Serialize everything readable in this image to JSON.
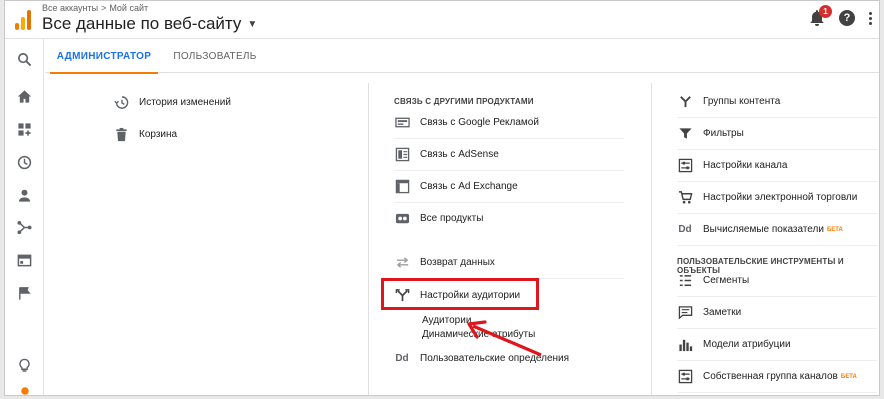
{
  "breadcrumb": {
    "account": "Все аккаунты",
    "separator": ">",
    "property": "Мой сайт"
  },
  "view_title": "Все данные по веб-сайту",
  "notifications_count": "1",
  "help_label": "?",
  "tabs": [
    {
      "label": "АДМИНИСТРАТОР",
      "active": true
    },
    {
      "label": "ПОЛЬЗОВАТЕЛЬ",
      "active": false
    }
  ],
  "account_column": {
    "items": [
      {
        "label": "История изменений",
        "icon": "history-icon"
      },
      {
        "label": "Корзина",
        "icon": "trash-icon"
      }
    ]
  },
  "property_column": {
    "section_label": "СВЯЗЬ С ДРУГИМИ ПРОДУКТАМИ",
    "items": [
      {
        "label": "Связь с Google Рекламой",
        "icon": "google-ads-icon"
      },
      {
        "label": "Связь с AdSense",
        "icon": "adsense-icon"
      },
      {
        "label": "Связь с Ad Exchange",
        "icon": "ad-exchange-icon"
      },
      {
        "label": "Все продукты",
        "icon": "all-products-icon"
      },
      {
        "label": "Возврат данных",
        "icon": "postbacks-icon"
      },
      {
        "label": "Настройки аудитории",
        "icon": "audience-icon"
      }
    ],
    "audience_sub": [
      "Аудитории",
      "Динамические атрибуты"
    ],
    "custom_definitions": {
      "label": "Пользовательские определения",
      "icon": "dd-icon"
    }
  },
  "view_column": {
    "items": [
      {
        "label": "Группы контента",
        "icon": "content-grouping-icon"
      },
      {
        "label": "Фильтры",
        "icon": "filter-icon"
      },
      {
        "label": "Настройки канала",
        "icon": "channel-settings-icon"
      },
      {
        "label": "Настройки электронной торговли",
        "icon": "cart-icon"
      },
      {
        "label": "Вычисляемые показатели",
        "icon": "dd-icon",
        "badge": "БЕТА"
      }
    ],
    "section_label": "ПОЛЬЗОВАТЕЛЬСКИЕ ИНСТРУМЕНТЫ И ОБЪЕКТЫ",
    "tools": [
      {
        "label": "Сегменты",
        "icon": "segments-icon"
      },
      {
        "label": "Заметки",
        "icon": "annotations-icon"
      },
      {
        "label": "Модели атрибуции",
        "icon": "attribution-icon"
      },
      {
        "label": "Собственная группа каналов",
        "icon": "custom-channel-icon",
        "badge": "БЕТА"
      }
    ]
  },
  "colors": {
    "accent": "#1a73e8",
    "tab_underline": "#f57c00",
    "highlight": "#e0161d",
    "beta": "#f57c00"
  }
}
